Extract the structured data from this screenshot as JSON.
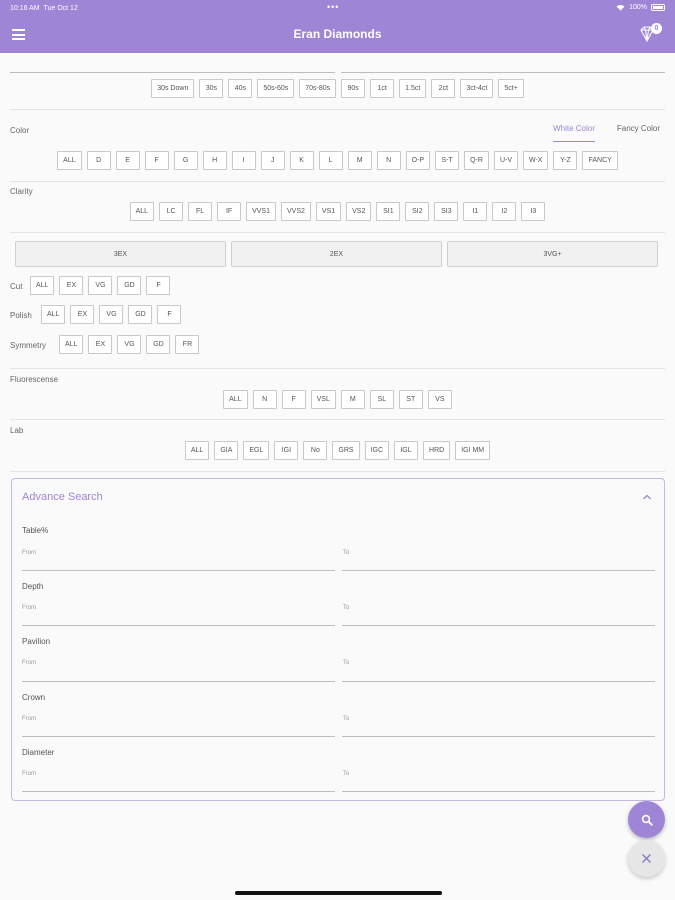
{
  "status": {
    "time": "10:16 AM",
    "date": "Tue Oct 12",
    "battery": "100%"
  },
  "app": {
    "title": "Eran Diamonds",
    "cart_count": "0"
  },
  "size": {
    "options": [
      "30s Down",
      "30s",
      "40s",
      "50s-60s",
      "70s-80s",
      "90s",
      "1ct",
      "1.5ct",
      "2ct",
      "3ct-4ct",
      "5ct+"
    ]
  },
  "color": {
    "label": "Color",
    "tabs": [
      {
        "label": "White Color",
        "active": true
      },
      {
        "label": "Fancy Color",
        "active": false
      }
    ],
    "options": [
      "ALL",
      "D",
      "E",
      "F",
      "G",
      "H",
      "I",
      "J",
      "K",
      "L",
      "M",
      "N",
      "O-P",
      "S-T",
      "Q-R",
      "U-V",
      "W-X",
      "Y-Z",
      "FANCY"
    ]
  },
  "clarity": {
    "label": "Clarity",
    "options": [
      "ALL",
      "LC",
      "FL",
      "IF",
      "VVS1",
      "VVS2",
      "VS1",
      "VS2",
      "SI1",
      "SI2",
      "SI3",
      "I1",
      "I2",
      "I3"
    ]
  },
  "quick": [
    "3EX",
    "2EX",
    "3VG+"
  ],
  "cut": {
    "label": "Cut",
    "options": [
      "ALL",
      "EX",
      "VG",
      "GD",
      "F"
    ]
  },
  "polish": {
    "label": "Polish",
    "options": [
      "ALL",
      "EX",
      "VG",
      "GD",
      "F"
    ]
  },
  "symmetry": {
    "label": "Symmetry",
    "options": [
      "ALL",
      "EX",
      "VG",
      "GD",
      "FR"
    ]
  },
  "fluorescence": {
    "label": "Fluorescense",
    "options": [
      "ALL",
      "N",
      "F",
      "VSL",
      "M",
      "SL",
      "ST",
      "VS"
    ]
  },
  "lab": {
    "label": "Lab",
    "options": [
      "ALL",
      "GIA",
      "EGL",
      "IGI",
      "No",
      "GRS",
      "IGC",
      "IGL",
      "HRD",
      "IGI MM"
    ]
  },
  "advance": {
    "title": "Advance Search",
    "from": "From",
    "to": "To",
    "fields": [
      "Table%",
      "Depth",
      "Pavilion",
      "Crown",
      "Diameter"
    ]
  },
  "colors": {
    "accent": "#9f85d6",
    "border": "#c9c9c9"
  }
}
